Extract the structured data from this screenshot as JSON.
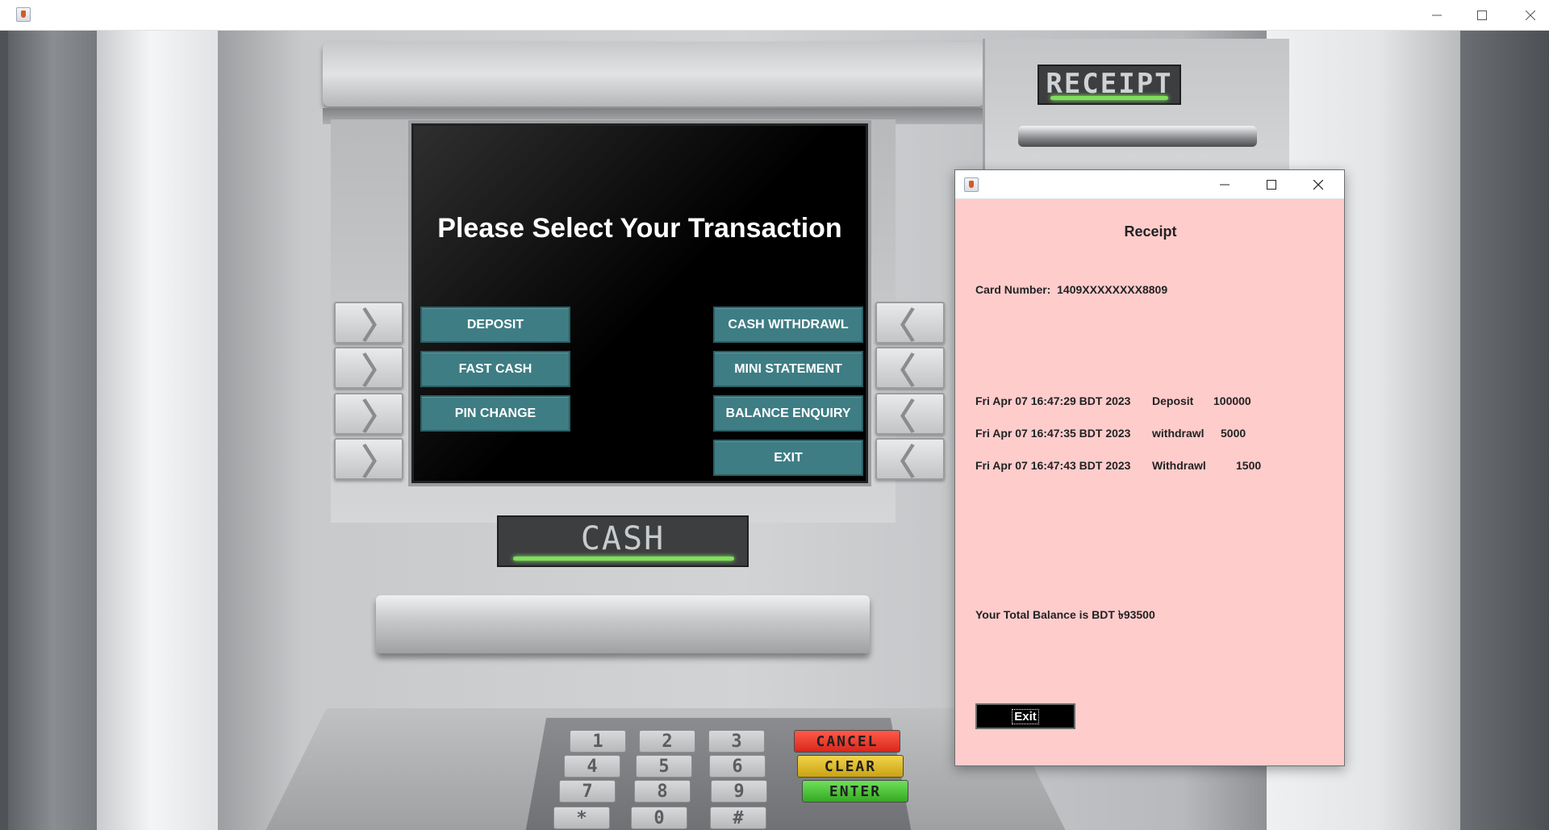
{
  "main_window": {
    "title": "",
    "controls": {
      "minimize": "minimize-icon",
      "maximize": "maximize-icon",
      "close": "close-icon"
    }
  },
  "atm": {
    "receipt_label": "RECEIPT",
    "cash_label": "CASH",
    "screen": {
      "title": "Please Select Your Transaction",
      "buttons_left": [
        "DEPOSIT",
        "FAST CASH",
        "PIN CHANGE"
      ],
      "buttons_right": [
        "CASH WITHDRAWL",
        "MINI STATEMENT",
        "BALANCE ENQUIRY",
        "EXIT"
      ]
    },
    "side_keys": {
      "left_glyph": "〉",
      "right_glyph": "〈"
    },
    "keypad": {
      "numbers": [
        "1",
        "2",
        "3",
        "4",
        "5",
        "6",
        "7",
        "8",
        "9",
        "*",
        "0",
        "#"
      ],
      "function_keys": {
        "cancel": "CANCEL",
        "clear": "CLEAR",
        "enter": "ENTER"
      }
    },
    "colors": {
      "button_teal": "#3e7d84",
      "indicator_green": "#7ee05a"
    }
  },
  "receipt_dialog": {
    "heading": "Receipt",
    "card_number": "Card Number:  1409XXXXXXXX8809",
    "transactions": [
      {
        "date": "Fri Apr 07 16:47:29 BDT 2023",
        "type": "Deposit",
        "amount": "100000"
      },
      {
        "date": "Fri Apr 07 16:47:35 BDT 2023",
        "type": "withdrawl",
        "amount": "5000"
      },
      {
        "date": "Fri Apr 07 16:47:43 BDT 2023",
        "type": "Withdrawl",
        "amount": "1500"
      }
    ],
    "total_balance": "Your Total Balance is BDT ৳93500",
    "exit_label": "Exit",
    "background_color": "#ffcccc"
  }
}
